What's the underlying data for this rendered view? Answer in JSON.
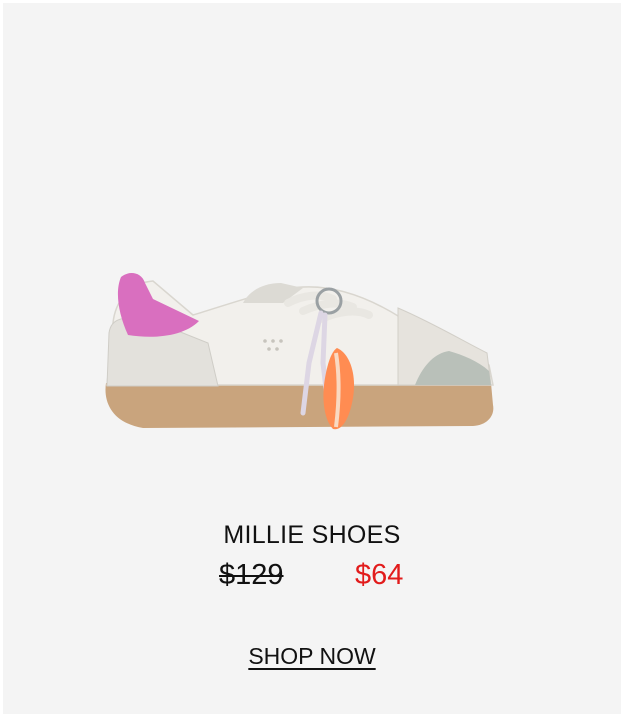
{
  "product": {
    "name": "MILLIE SHOES",
    "original_price": "$129",
    "sale_price": "$64",
    "image_subject": "white leather low-top sneaker with pink heel tab, silver toe accent, gum sole and orange surfboard keychain charm"
  },
  "cta": {
    "label": "SHOP NOW"
  },
  "colors": {
    "background": "#f4f4f4",
    "sale_price": "#e21b1b",
    "text": "#111111"
  }
}
